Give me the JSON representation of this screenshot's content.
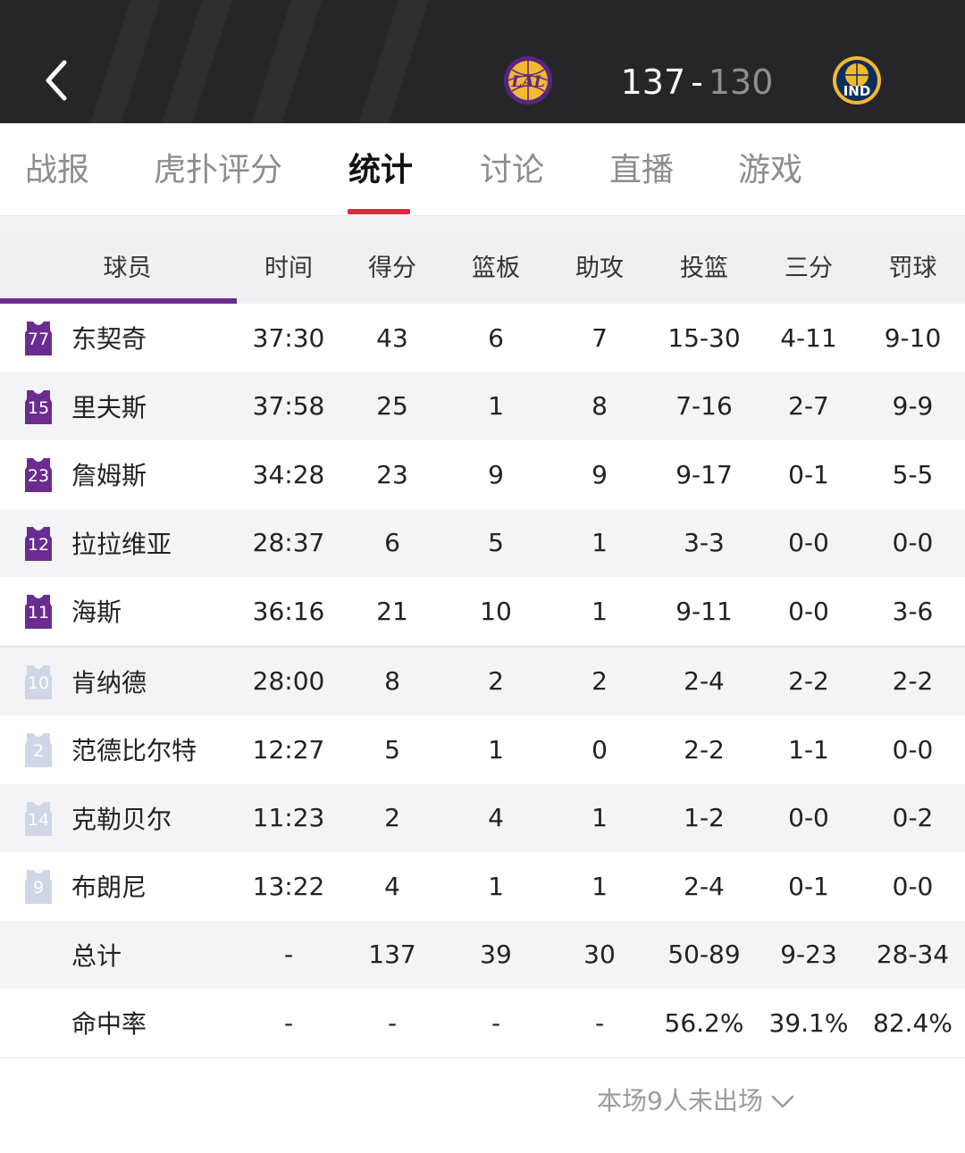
{
  "header": {
    "home_team_logo_text": "LAL",
    "away_team_logo_text": "IND",
    "home_score": "137",
    "separator": "-",
    "away_score": "130"
  },
  "tabs": [
    {
      "label": "战报"
    },
    {
      "label": "虎扑评分"
    },
    {
      "label": "统计",
      "active": true
    },
    {
      "label": "讨论"
    },
    {
      "label": "直播"
    },
    {
      "label": "游戏"
    }
  ],
  "columns": [
    "球员",
    "时间",
    "得分",
    "篮板",
    "助攻",
    "投篮",
    "三分",
    "罚球"
  ],
  "starters": [
    {
      "number": "77",
      "name": "东契奇",
      "min": "37:30",
      "pts": "43",
      "reb": "6",
      "ast": "7",
      "fg": "15-30",
      "tp": "4-11",
      "ft": "9-10"
    },
    {
      "number": "15",
      "name": "里夫斯",
      "min": "37:58",
      "pts": "25",
      "reb": "1",
      "ast": "8",
      "fg": "7-16",
      "tp": "2-7",
      "ft": "9-9"
    },
    {
      "number": "23",
      "name": "詹姆斯",
      "min": "34:28",
      "pts": "23",
      "reb": "9",
      "ast": "9",
      "fg": "9-17",
      "tp": "0-1",
      "ft": "5-5"
    },
    {
      "number": "12",
      "name": "拉拉维亚",
      "min": "28:37",
      "pts": "6",
      "reb": "5",
      "ast": "1",
      "fg": "3-3",
      "tp": "0-0",
      "ft": "0-0"
    },
    {
      "number": "11",
      "name": "海斯",
      "min": "36:16",
      "pts": "21",
      "reb": "10",
      "ast": "1",
      "fg": "9-11",
      "tp": "0-0",
      "ft": "3-6"
    }
  ],
  "bench": [
    {
      "number": "10",
      "name": "肯纳德",
      "min": "28:00",
      "pts": "8",
      "reb": "2",
      "ast": "2",
      "fg": "2-4",
      "tp": "2-2",
      "ft": "2-2"
    },
    {
      "number": "2",
      "name": "范德比尔特",
      "min": "12:27",
      "pts": "5",
      "reb": "1",
      "ast": "0",
      "fg": "2-2",
      "tp": "1-1",
      "ft": "0-0"
    },
    {
      "number": "14",
      "name": "克勒贝尔",
      "min": "11:23",
      "pts": "2",
      "reb": "4",
      "ast": "1",
      "fg": "1-2",
      "tp": "0-0",
      "ft": "0-2"
    },
    {
      "number": "9",
      "name": "布朗尼",
      "min": "13:22",
      "pts": "4",
      "reb": "1",
      "ast": "1",
      "fg": "2-4",
      "tp": "0-1",
      "ft": "0-0"
    }
  ],
  "totals": {
    "name": "总计",
    "min": "-",
    "pts": "137",
    "reb": "39",
    "ast": "30",
    "fg": "50-89",
    "tp": "9-23",
    "ft": "28-34"
  },
  "percentages": {
    "name": "命中率",
    "min": "-",
    "pts": "-",
    "reb": "-",
    "ast": "-",
    "fg": "56.2%",
    "tp": "39.1%",
    "ft": "82.4%"
  },
  "footer": {
    "dnp_text": "本场9人未出场"
  },
  "colors": {
    "header_bg": "#26262a",
    "accent_red": "#e0263a",
    "lakers_purple": "#6b2c91",
    "lakers_gold": "#f5b82e",
    "bench_jersey": "#cfd6e6"
  },
  "icons": [
    "back-arrow-icon",
    "lakers-logo",
    "pacers-logo",
    "jersey-icon",
    "chevron-down-icon"
  ]
}
